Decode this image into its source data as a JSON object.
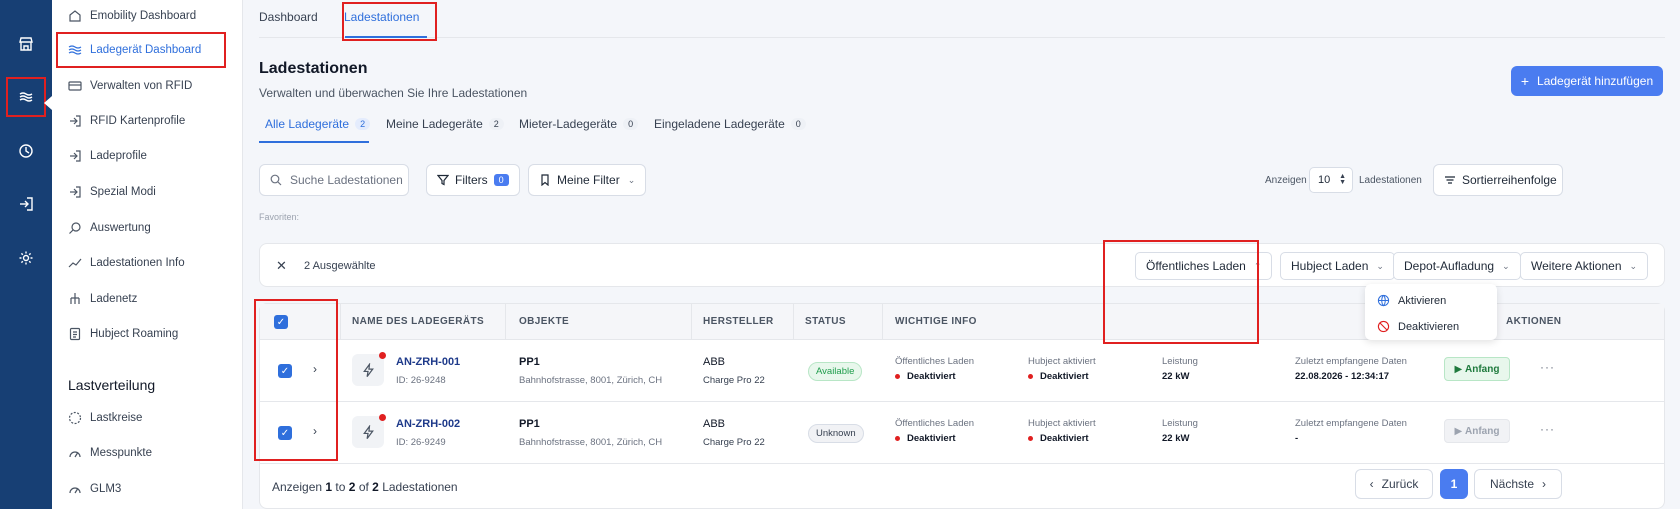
{
  "sidebar": {
    "items": [
      {
        "label": "Emobility Dashboard",
        "icon": "home-icon"
      },
      {
        "label": "Ladegerät Dashboard",
        "icon": "waves-icon"
      },
      {
        "label": "Verwalten von RFID",
        "icon": "card-icon"
      },
      {
        "label": "RFID Kartenprofile",
        "icon": "login-icon"
      },
      {
        "label": "Ladeprofile",
        "icon": "login-icon"
      },
      {
        "label": "Spezial Modi",
        "icon": "login-icon"
      },
      {
        "label": "Auswertung",
        "icon": "search-icon"
      },
      {
        "label": "Ladestationen Info",
        "icon": "trend-icon"
      },
      {
        "label": "Ladenetz",
        "icon": "network-icon"
      },
      {
        "label": "Hubject Roaming",
        "icon": "document-icon"
      }
    ],
    "section_title": "Lastverteilung",
    "section_items": [
      {
        "label": "Lastkreise",
        "icon": "circle-icon"
      },
      {
        "label": "Messpunkte",
        "icon": "gauge-icon"
      },
      {
        "label": "GLM3",
        "icon": "gauge-icon"
      }
    ]
  },
  "top_tabs": [
    "Dashboard",
    "Ladestationen"
  ],
  "header": {
    "title": "Ladestationen",
    "subtitle": "Verwalten und überwachen Sie Ihre Ladestationen",
    "add_button": "Ladegerät hinzufügen"
  },
  "sub_tabs": [
    {
      "label": "Alle Ladegeräte",
      "count": "2"
    },
    {
      "label": "Meine Ladegeräte",
      "count": "2"
    },
    {
      "label": "Mieter-Ladegeräte",
      "count": "0"
    },
    {
      "label": "Eingeladene Ladegeräte",
      "count": "0"
    }
  ],
  "toolbar": {
    "search_placeholder": "Suche Ladestationen",
    "filters_label": "Filters",
    "filters_count": "0",
    "my_filter_label": "Meine Filter",
    "show_label": "Anzeigen",
    "show_value": "10",
    "stations_label": "Ladestationen",
    "sort_label": "Sortierreihenfolge",
    "favorites_label": "Favoriten:"
  },
  "selection": {
    "count_label": "2 Ausgewählte",
    "actions": [
      "Öffentliches Laden",
      "Hubject Laden",
      "Depot-Aufladung",
      "Weitere Aktionen"
    ],
    "dropdown": [
      "Aktivieren",
      "Deaktivieren"
    ]
  },
  "table": {
    "headers": [
      "NAME DES LADEGERÄTS",
      "OBJEKTE",
      "HERSTELLER",
      "STATUS",
      "WICHTIGE INFO",
      "AKTIONEN"
    ],
    "rows": [
      {
        "name": "AN-ZRH-001",
        "id": "ID: 26-9248",
        "object": "PP1",
        "address": "Bahnhofstrasse, 8001, Zürich, CH",
        "maker": "ABB",
        "model": "Charge Pro 22",
        "status": "Available",
        "public_label": "Öffentliches Laden",
        "public_val": "Deaktiviert",
        "hubject_label": "Hubject aktiviert",
        "hubject_val": "Deaktiviert",
        "power_label": "Leistung",
        "power_val": "22 kW",
        "last_label": "Zuletzt empfangene Daten",
        "last_val": "22.08.2026 - 12:34:17",
        "action": "Anfang"
      },
      {
        "name": "AN-ZRH-002",
        "id": "ID: 26-9249",
        "object": "PP1",
        "address": "Bahnhofstrasse, 8001, Zürich, CH",
        "maker": "ABB",
        "model": "Charge Pro 22",
        "status": "Unknown",
        "public_label": "Öffentliches Laden",
        "public_val": "Deaktiviert",
        "hubject_label": "Hubject aktiviert",
        "hubject_val": "Deaktiviert",
        "power_label": "Leistung",
        "power_val": "22 kW",
        "last_label": "Zuletzt empfangene Daten",
        "last_val": "-",
        "action": "Anfang"
      }
    ]
  },
  "footer": {
    "prefix": "Anzeigen",
    "from": "1",
    "to_word": "to",
    "to": "2",
    "of_word": "of",
    "total": "2",
    "suffix": "Ladestationen",
    "prev": "Zurück",
    "page": "1",
    "next": "Nächste"
  },
  "colors": {
    "rail": "#173f74",
    "accent": "#4a7cf0",
    "highlight": "#e02020"
  }
}
